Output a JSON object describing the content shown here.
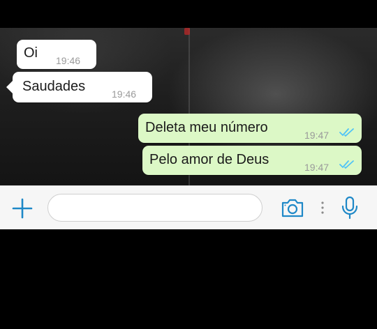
{
  "messages": [
    {
      "direction": "incoming",
      "text": "Oi",
      "time": "19:46"
    },
    {
      "direction": "incoming",
      "text": "Saudades",
      "time": "19:46"
    },
    {
      "direction": "outgoing",
      "text": "Deleta meu número",
      "time": "19:47",
      "status": "read"
    },
    {
      "direction": "outgoing",
      "text": "Pelo amor de Deus",
      "time": "19:47",
      "status": "read"
    }
  ],
  "composer": {
    "input_value": "",
    "input_placeholder": "",
    "icons": [
      "plus-icon",
      "camera-icon",
      "more-dots-icon",
      "microphone-icon"
    ]
  },
  "colors": {
    "incoming_bubble": "#ffffff",
    "outgoing_bubble": "#dcf8c6",
    "read_ticks": "#4fc3f7",
    "accent": "#1e88c7"
  }
}
